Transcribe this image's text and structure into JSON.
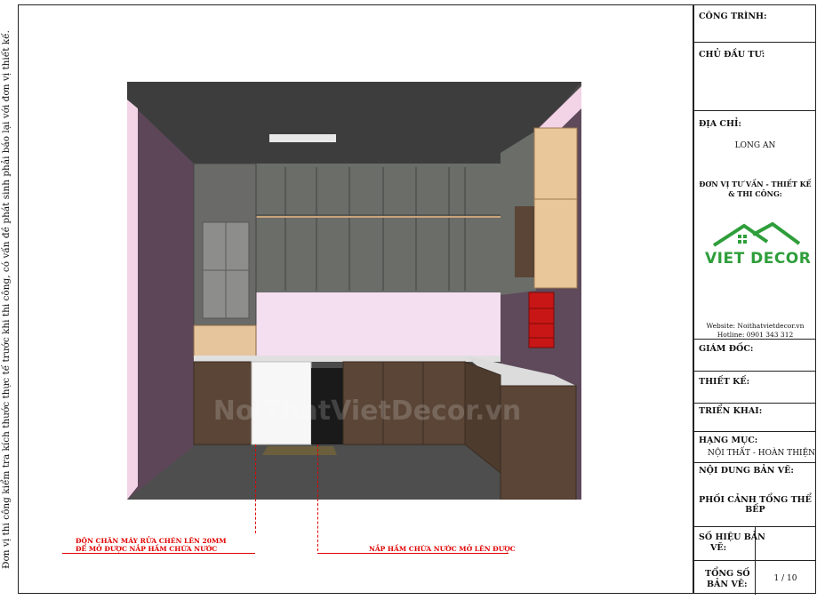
{
  "side_note": "Đơn vị thi công kiểm tra kích thước thực tế trước khi thi công, có vấn đề phát sinh phải báo lại với đơn vị thiết kế.",
  "watermark": "NoiThatVietDecor.vn",
  "annotations": {
    "left_line1": "ĐÔN CHÂN MÁY RỬA CHÉN LÊN 20MM",
    "left_line2": "ĐỂ MỞ ĐƯỢC NẮP HẦM CHỨA NƯỚC",
    "right": "NẮP HẦM CHỨA NƯỚC MỞ LÊN ĐƯỢC"
  },
  "title_block": {
    "cong_trinh_label": "CÔNG TRÌNH:",
    "chu_dau_tu_label": "CHỦ ĐẦU TƯ:",
    "dia_chi_label": "ĐỊA CHỈ:",
    "dia_chi_value": "LONG AN",
    "don_vi_line1": "ĐƠN VỊ TƯ VẤN - THIẾT KẾ",
    "don_vi_line2": "& THI CÔNG:",
    "logo_text": "VIET DECOR",
    "website": "Website: Noithatvietdecor.vn",
    "hotline": "Hotline: 0901 343 312",
    "giam_doc_label": "GIÁM ĐỐC:",
    "thiet_ke_label": "THIẾT KẾ:",
    "trien_khai_label": "TRIỂN KHAI:",
    "hang_muc_label": "HẠNG MỤC:",
    "hang_muc_value": "NỘI THẤT - HOÀN THIỆN",
    "noi_dung_label": "NỘI DUNG BẢN VẼ:",
    "noi_dung_value": "PHỐI CẢNH TỔNG THỂ BẾP",
    "so_hieu_label1": "SỐ HIỆU BẢN",
    "so_hieu_label2": "VẼ:",
    "tong_so_label1": "TỔNG SỐ",
    "tong_so_label2": "BẢN VẼ:",
    "tong_so_value": "1 / 10"
  },
  "colors": {
    "accent_green": "#2e9e3a",
    "annotation_red": "#e00000",
    "wall_purple": "#5e4a5a",
    "upper_cabinet_grey": "#6b6d69",
    "lower_cabinet_wood": "#5a4536"
  }
}
